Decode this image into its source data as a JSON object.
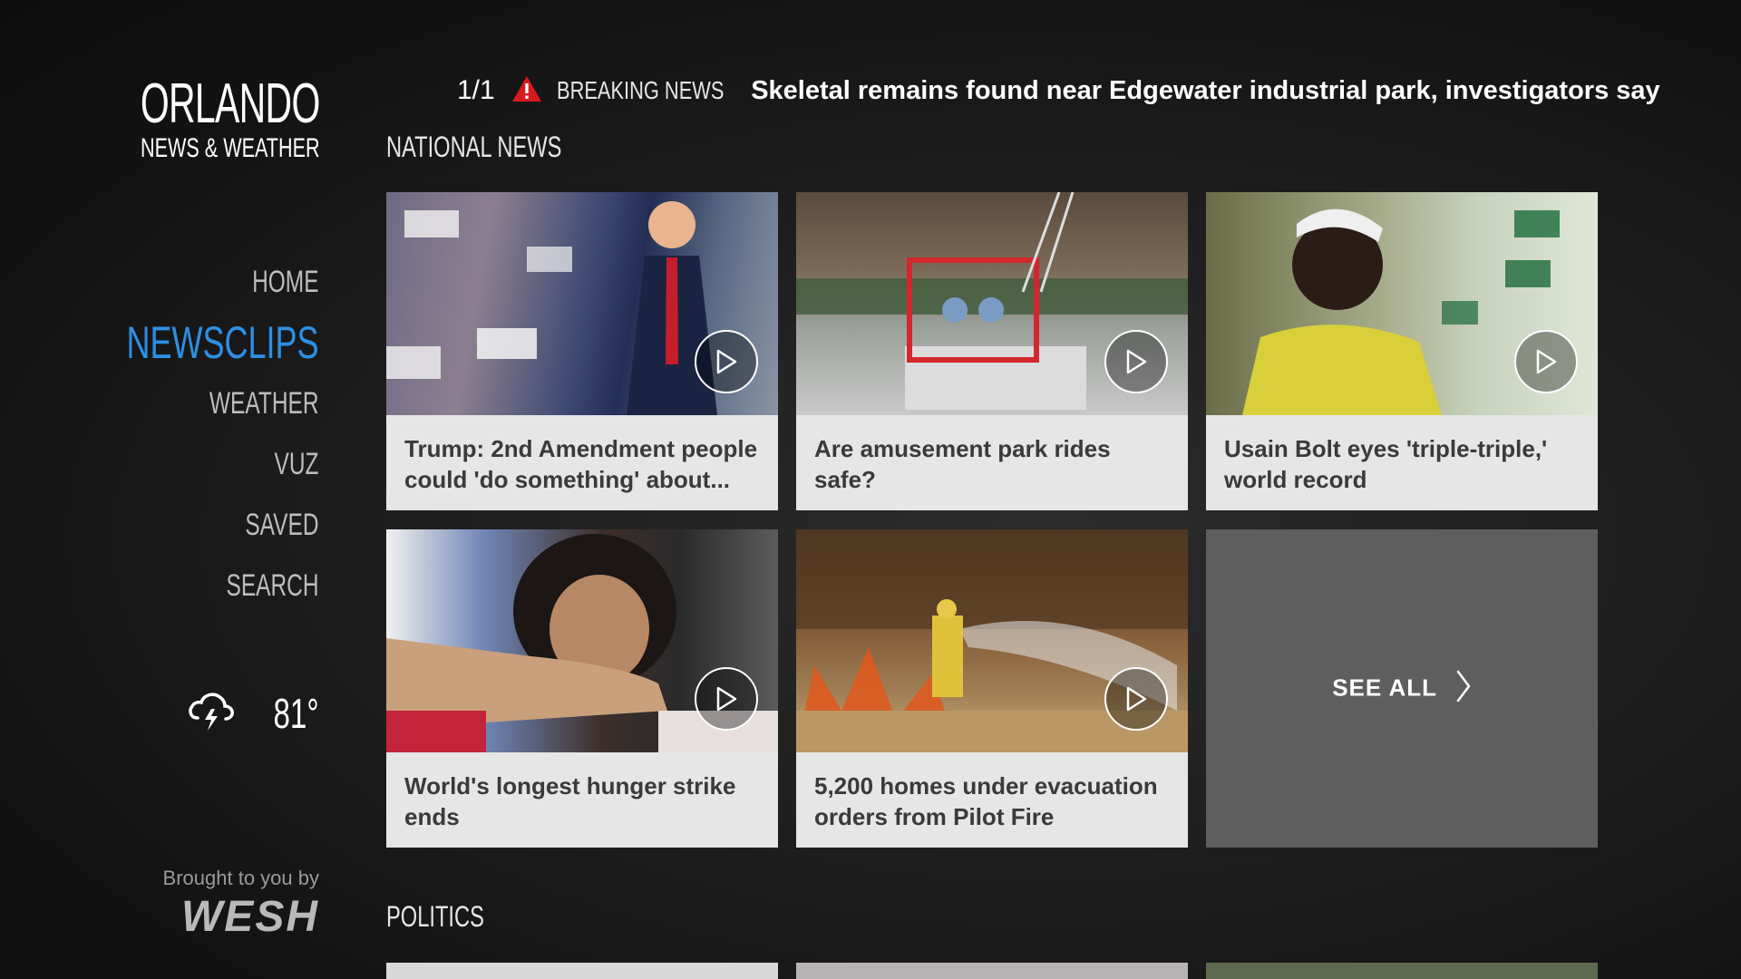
{
  "brand": {
    "city": "ORLANDO",
    "subtitle": "NEWS & WEATHER"
  },
  "nav": [
    {
      "label": "HOME",
      "active": false
    },
    {
      "label": "NEWSCLIPS",
      "active": true
    },
    {
      "label": "WEATHER",
      "active": false
    },
    {
      "label": "VUZ",
      "active": false
    },
    {
      "label": "SAVED",
      "active": false
    },
    {
      "label": "SEARCH",
      "active": false
    }
  ],
  "weather": {
    "icon": "thunderstorm-icon",
    "temperature": "81°"
  },
  "sponsor": {
    "label": "Brought to you by",
    "name": "WESH"
  },
  "breaking": {
    "count": "1/1",
    "icon": "alert-icon",
    "label": "BREAKING NEWS",
    "headline": "Skeletal remains found near Edgewater industrial park, investigators say"
  },
  "sections": [
    {
      "title": "NATIONAL NEWS",
      "cards": [
        {
          "title": "Trump: 2nd Amendment people could 'do something' about...",
          "icon": "play-icon"
        },
        {
          "title": "Are amusement park rides safe?",
          "icon": "play-icon"
        },
        {
          "title": "Usain Bolt eyes 'triple-triple,' world record",
          "icon": "play-icon"
        },
        {
          "title": "World's longest hunger strike ends",
          "icon": "play-icon"
        },
        {
          "title": "5,200 homes under evacuation orders from Pilot Fire",
          "icon": "play-icon"
        }
      ],
      "see_all": "SEE ALL"
    },
    {
      "title": "POLITICS"
    }
  ],
  "colors": {
    "accent": "#2d8fe3",
    "alert": "#d71920",
    "card": "#e6e6e6",
    "see_all_bg": "#5e5e5e"
  }
}
